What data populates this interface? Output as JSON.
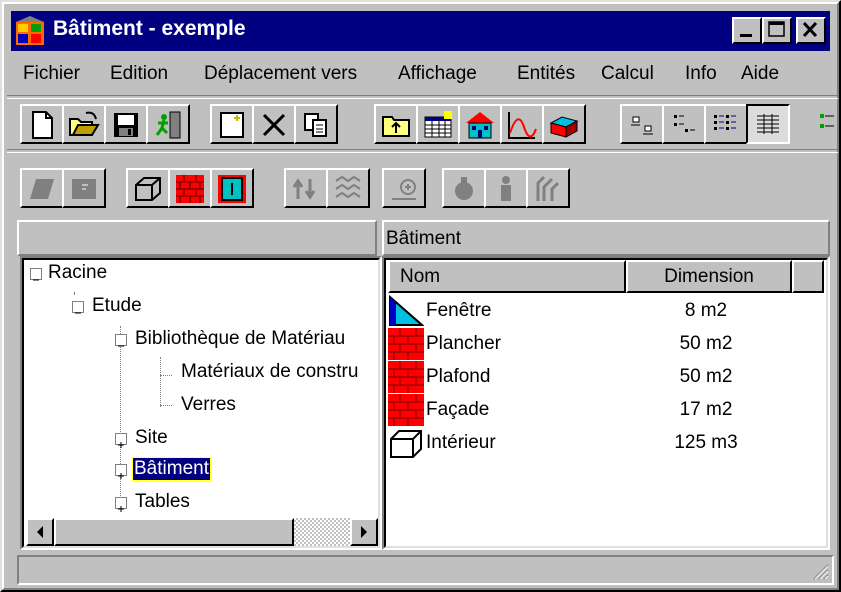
{
  "window": {
    "title": "Bâtiment - exemple"
  },
  "menu": [
    "Fichier",
    "Edition",
    "Déplacement vers",
    "Affichage",
    "Entités",
    "Calcul",
    "Info",
    "Aide"
  ],
  "toolbar1_icons": [
    "new-document-icon",
    "open-folder-icon",
    "save-disk-icon",
    "exit-man-icon",
    "properties-icon",
    "delete-x-icon",
    "copy-icon",
    "up-folder-icon",
    "table-icon",
    "building-icon",
    "curve-chart-icon",
    "brick-block-icon",
    "large-icons-view-icon",
    "small-icons-view-icon",
    "list-view-icon",
    "details-view-icon",
    "more-icon"
  ],
  "toolbar2_icons": [
    "wall-disabled-icon",
    "floor-disabled-icon",
    "cube-icon",
    "brick-wall-icon",
    "window-icon",
    "move-disabled-icon",
    "pattern-disabled-icon",
    "connect-disabled-icon",
    "valve-disabled-icon",
    "person-disabled-icon",
    "tree-disabled-icon"
  ],
  "left_pane": {
    "header": ""
  },
  "tree": [
    {
      "label": "Racine",
      "expander": "−",
      "level": 0
    },
    {
      "label": "Etude",
      "expander": "−",
      "level": 1
    },
    {
      "label": "Bibliothèque de Matériau",
      "expander": "−",
      "level": 2
    },
    {
      "label": "Matériaux de constru",
      "expander": "",
      "level": 3
    },
    {
      "label": "Verres",
      "expander": "",
      "level": 3
    },
    {
      "label": "Site",
      "expander": "+",
      "level": 2
    },
    {
      "label": "Bâtiment",
      "expander": "+",
      "level": 2,
      "selected": true
    },
    {
      "label": "Tables",
      "expander": "+",
      "level": 2
    }
  ],
  "right_pane": {
    "header": "Bâtiment",
    "columns": [
      "Nom",
      "Dimension"
    ],
    "rows": [
      {
        "icon": "window-pane-icon",
        "nom": "Fenêtre",
        "dimension": "8 m2"
      },
      {
        "icon": "brick-wall-icon",
        "nom": "Plancher",
        "dimension": "50 m2"
      },
      {
        "icon": "brick-wall-icon",
        "nom": "Plafond",
        "dimension": "50 m2"
      },
      {
        "icon": "brick-wall-icon",
        "nom": "Façade",
        "dimension": "17 m2"
      },
      {
        "icon": "cube-icon",
        "nom": "Intérieur",
        "dimension": "125 m3"
      }
    ]
  },
  "status": {
    "text": ""
  }
}
